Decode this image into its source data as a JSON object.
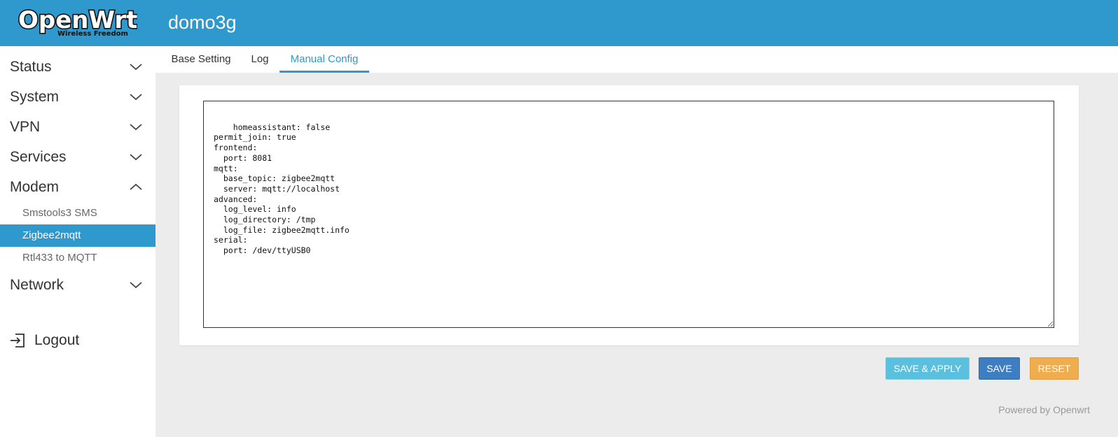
{
  "header": {
    "brand": "OpenWrt",
    "brand_tagline": "Wireless Freedom",
    "hostname": "domo3g",
    "color": "#2f98cd"
  },
  "sidebar": {
    "menu": [
      {
        "label": "Status",
        "icon": "chevron-down-icon"
      },
      {
        "label": "System",
        "icon": "chevron-down-icon"
      },
      {
        "label": "VPN",
        "icon": "chevron-down-icon"
      },
      {
        "label": "Services",
        "icon": "chevron-down-icon"
      },
      {
        "label": "Modem",
        "icon": "chevron-up-icon"
      }
    ],
    "submenu": [
      {
        "label": "Smstools3 SMS"
      },
      {
        "label": "Zigbee2mqtt",
        "active": true
      },
      {
        "label": "Rtl433 to MQTT"
      }
    ],
    "network": {
      "label": "Network",
      "icon": "chevron-down-icon"
    },
    "logout": {
      "label": "Logout",
      "icon": "logout-icon"
    }
  },
  "tabs": [
    {
      "label": "Base Setting"
    },
    {
      "label": "Log"
    },
    {
      "label": "Manual Config",
      "active": true
    }
  ],
  "editor": {
    "content": "homeassistant: false\npermit_join: true\nfrontend:\n  port: 8081\nmqtt:\n  base_topic: zigbee2mqtt\n  server: mqtt://localhost\nadvanced:\n  log_level: info\n  log_directory: /tmp\n  log_file: zigbee2mqtt.info\nserial:\n  port: /dev/ttyUSB0"
  },
  "actions": {
    "save_apply": "SAVE & APPLY",
    "save": "SAVE",
    "reset": "RESET"
  },
  "footer": {
    "text": "Powered by Openwrt"
  }
}
